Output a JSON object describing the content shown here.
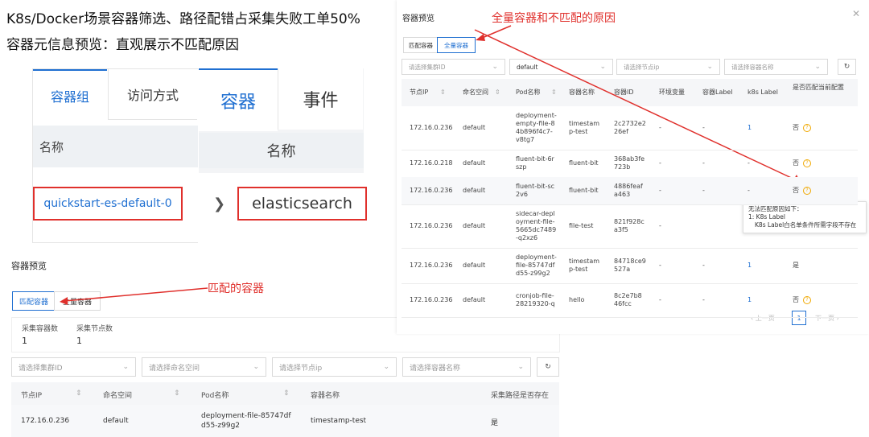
{
  "headline": {
    "line1": "K8s/Docker场景容器筛选、路径配错占采集失败工单50%",
    "line2": "容器元信息预览：直观展示不匹配原因"
  },
  "top_left": {
    "tabs_a": [
      "容器组",
      "访问方式"
    ],
    "tabs_b": [
      "容器",
      "事件"
    ],
    "col_name_a": "名称",
    "col_name_b": "名称",
    "pod_link": "quickstart-es-default-0",
    "container_name": "elasticsearch"
  },
  "bottom_panel": {
    "title": "容器预览",
    "tabs": [
      "匹配容器",
      "全量容器"
    ],
    "annotation": "匹配的容器",
    "stats": [
      {
        "label": "采集容器数",
        "value": "1"
      },
      {
        "label": "采集节点数",
        "value": "1"
      }
    ],
    "filters": [
      "请选择集群ID",
      "请选择命名空间",
      "请选择节点ip",
      "请选择容器名称"
    ],
    "columns": [
      "节点IP",
      "命名空间",
      "Pod名称",
      "容器名称",
      "采集路径是否存在"
    ],
    "row": {
      "ip": "172.16.0.236",
      "ns": "default",
      "pod": "deployment-file-85747df d55-z99g2",
      "container": "timestamp-test",
      "exists": "是"
    }
  },
  "right_panel": {
    "title": "容器预览",
    "tabs": [
      "匹配容器",
      "全量容器"
    ],
    "annotation": "全量容器和不匹配的原因",
    "filters": [
      "请选择集群ID",
      "default",
      "请选择节点ip",
      "请选择容器名称"
    ],
    "columns": [
      "节点IP",
      "命名空间",
      "Pod名称",
      "容器名称",
      "容器ID",
      "环境变量",
      "容器Label",
      "k8s Label",
      "是否匹配当前配置"
    ],
    "rows": [
      {
        "ip": "172.16.0.236",
        "ns": "default",
        "pod": "deployment-\nempty-file-8\n4b896f4c7-\nv8tg7",
        "name": "timestam\np-test",
        "id": "2c2732e2\n26ef",
        "env": "-",
        "label": "-",
        "k8s": "1",
        "match": "否"
      },
      {
        "ip": "172.16.0.218",
        "ns": "default",
        "pod": "fluent-bit-6r\nszp",
        "name": "fluent-bit",
        "id": "368ab3fe\n723b",
        "env": "-",
        "label": "-",
        "k8s": "-",
        "match": "否"
      },
      {
        "ip": "172.16.0.236",
        "ns": "default",
        "pod": "fluent-bit-sc\n2v6",
        "name": "fluent-bit",
        "id": "4886feaf\na463",
        "env": "-",
        "label": "-",
        "k8s": "-",
        "match": "否"
      },
      {
        "ip": "172.16.0.236",
        "ns": "default",
        "pod": "sidecar-depl\noyment-file-\n5665dc7489\n-q2xz6",
        "name": "file-test",
        "id": "821f928c\na3f5",
        "env": "-",
        "label": "",
        "k8s": "",
        "match": ""
      },
      {
        "ip": "172.16.0.236",
        "ns": "default",
        "pod": "deployment-\nfile-85747df\nd55-z99g2",
        "name": "timestam\np-test",
        "id": "84718ce9\n527a",
        "env": "-",
        "label": "-",
        "k8s": "1",
        "match": "是"
      },
      {
        "ip": "172.16.0.236",
        "ns": "default",
        "pod": "cronjob-file-\n28219320-q",
        "name": "hello",
        "id": "8c2e7b8\n46fcc",
        "env": "-",
        "label": "-",
        "k8s": "1",
        "match": "否"
      }
    ],
    "tooltip": {
      "line1": "无法匹配原因如下：",
      "line2": "1: K8s Label",
      "line3": "K8s Label白名单条件所需字段不存在"
    },
    "pagination": {
      "prev": "上一页",
      "page": "1",
      "next": "下一页"
    }
  },
  "colors": {
    "accent": "#1f6fd1",
    "annotation": "#e0302c",
    "warning": "#f0a800"
  }
}
